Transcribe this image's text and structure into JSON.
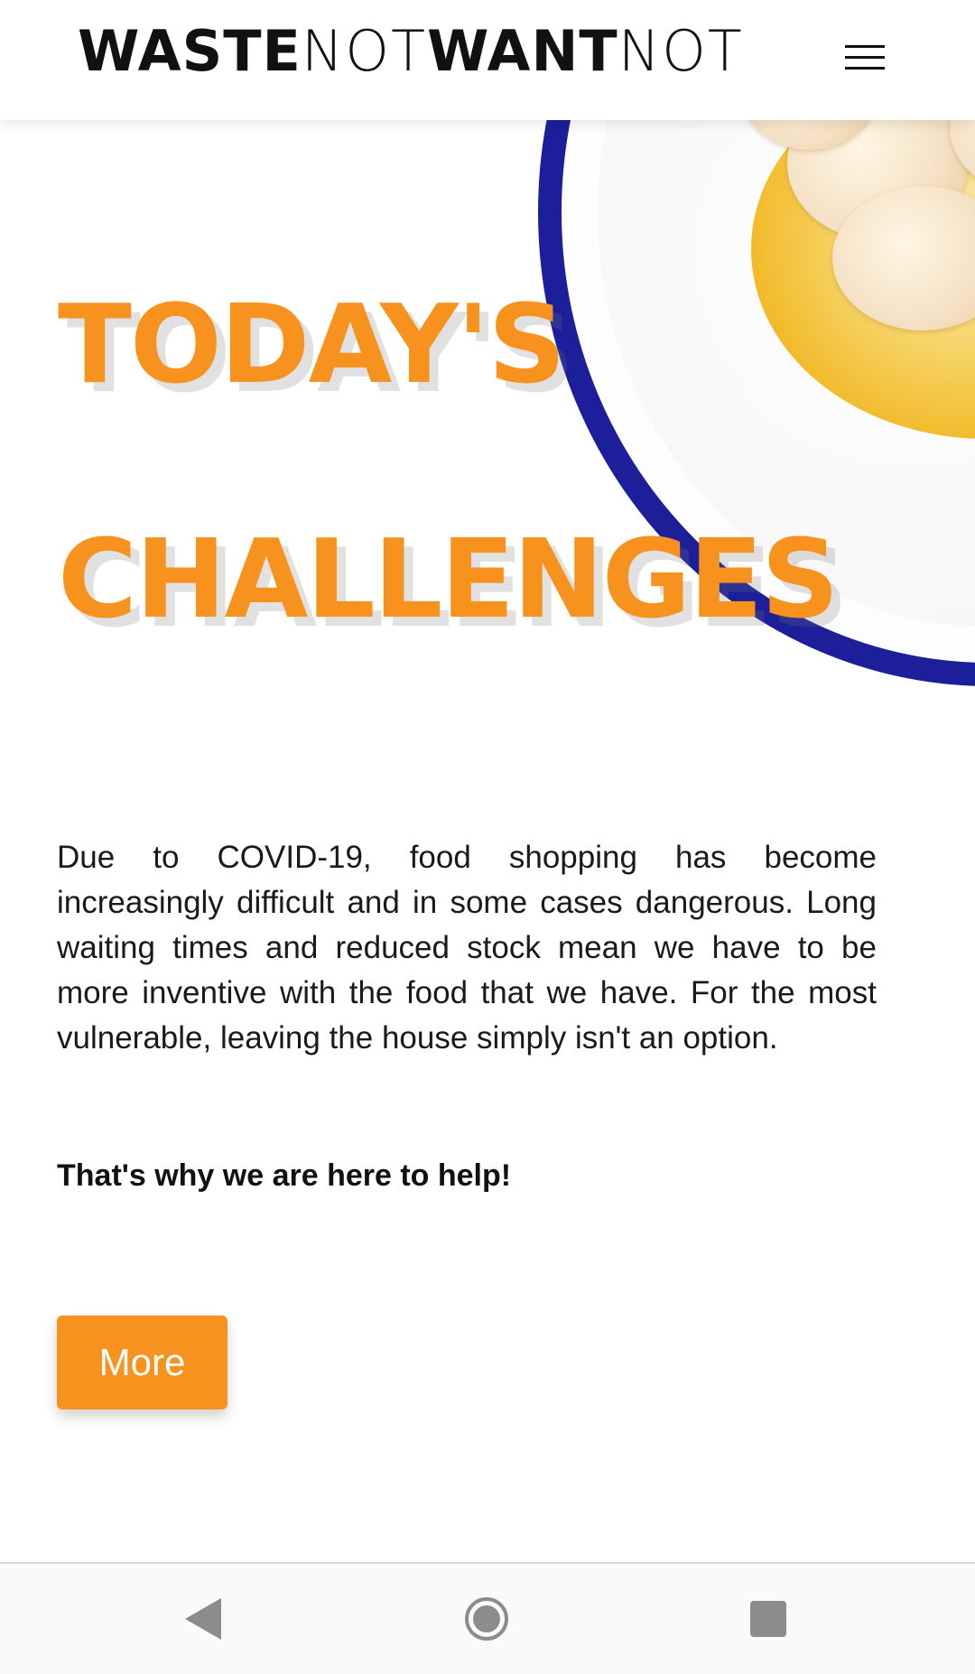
{
  "header": {
    "logo": {
      "part1": "WASTE",
      "part2": "NOT",
      "part3": "WANT",
      "part4": "NOT"
    },
    "menu_icon": "hamburger-menu-icon"
  },
  "hero": {
    "headline_line1": "TODAY'S",
    "headline_line2": "CHALLENGES",
    "image": "plated-scallop-dish-image"
  },
  "content": {
    "intro": "Due to COVID-19, food shopping has become increasingly difficult and in some cases dangerous. Long waiting times and reduced stock mean we have to be more inventive with the food that we have. For the most vulnerable, leaving the house simply isn't an option.",
    "tagline": "That's why we are here to help!",
    "more_label": "More"
  },
  "navbar": {
    "back_icon": "back-triangle-icon",
    "home_icon": "home-circle-icon",
    "recent_icon": "recent-apps-square-icon"
  },
  "colors": {
    "accent": "#f7921e",
    "plate_rim": "#1d1f9a",
    "text": "#1a1a1a"
  }
}
